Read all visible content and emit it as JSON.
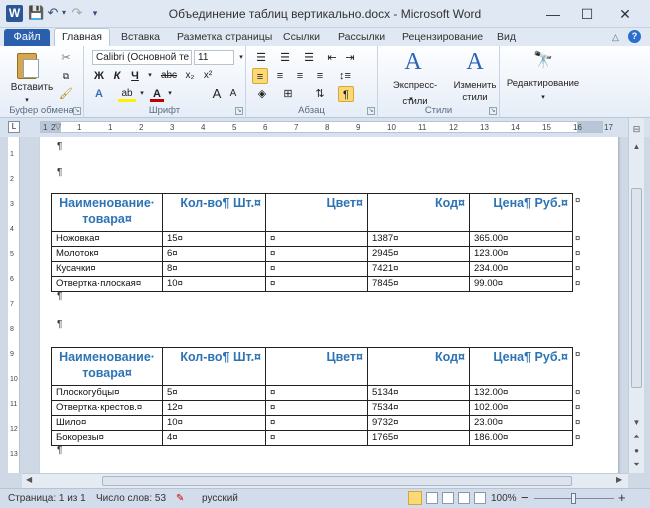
{
  "app": {
    "title": "Объединение таблиц вертикально.docx  -  Microsoft Word",
    "logo_letter": "W",
    "qat": {
      "save": "💾",
      "undo": "↶",
      "redo": "↷"
    },
    "window_controls": {
      "minimize": "—",
      "maximize": "☐",
      "close": "✕"
    }
  },
  "ribbon_tabs": {
    "file": "Файл",
    "items": [
      "Главная",
      "Вставка",
      "Разметка страницы",
      "Ссылки",
      "Рассылки",
      "Рецензирование",
      "Вид"
    ]
  },
  "ribbon": {
    "clipboard": {
      "paste_label": "Вставить",
      "group_label": "Буфер обмена"
    },
    "font": {
      "font_name": "Calibri (Основной те",
      "font_size": "11",
      "grow": "A",
      "shrink": "A",
      "bold": "Ж",
      "italic": "К",
      "underline": "Ч",
      "strike": "abc",
      "subscript": "x₂",
      "superscript": "x²",
      "color_a": "A",
      "highlight": "ab",
      "font_color": "A",
      "case": "Aa",
      "group_label": "Шрифт"
    },
    "paragraph": {
      "pilcrow": "¶",
      "group_label": "Абзац"
    },
    "styles": {
      "express_label": "Экспресс-стили",
      "change_label": "Изменить",
      "change_label2": "стили",
      "group_label": "Стили"
    },
    "editing": {
      "label": "Редактирование"
    }
  },
  "ruler": {
    "numbers": [
      "1",
      "2",
      "1",
      "1",
      "2",
      "3",
      "4",
      "5",
      "6",
      "7",
      "8",
      "9",
      "10",
      "11",
      "12",
      "13",
      "14",
      "15",
      "16",
      "17"
    ],
    "tab_button": "L"
  },
  "vruler": {
    "numbers": [
      "1",
      "2",
      "3",
      "4",
      "5",
      "6",
      "7",
      "8",
      "9",
      "10",
      "11",
      "12",
      "13"
    ]
  },
  "document": {
    "pilcrow": "¶",
    "cell_mark": "¤",
    "headers": [
      "Наименование· товара¤",
      "Кол-во¶ Шт.¤",
      "Цвет¤",
      "Код¤",
      "Цена¶ Руб.¤"
    ],
    "table1": [
      [
        "Ножовка¤",
        "15¤",
        "¤",
        "1387¤",
        "365.00¤"
      ],
      [
        "Молоток¤",
        "6¤",
        "¤",
        "2945¤",
        "123.00¤"
      ],
      [
        "Кусачки¤",
        "8¤",
        "¤",
        "7421¤",
        "234.00¤"
      ],
      [
        "Отвертка·плоская¤",
        "10¤",
        "¤",
        "7845¤",
        "99.00¤"
      ]
    ],
    "table2": [
      [
        "Плоскогубцы¤",
        "5¤",
        "¤",
        "5134¤",
        "132.00¤"
      ],
      [
        "Отвертка·крестов.¤",
        "12¤",
        "¤",
        "7534¤",
        "102.00¤"
      ],
      [
        "Шило¤",
        "10¤",
        "¤",
        "9732¤",
        "23.00¤"
      ],
      [
        "Бокорезы¤",
        "4¤",
        "¤",
        "1765¤",
        "186.00¤"
      ]
    ]
  },
  "statusbar": {
    "page": "Страница: 1 из 1",
    "words": "Число слов: 53",
    "language": "русский",
    "zoom": "100%",
    "zoom_minus": "−",
    "zoom_plus": "+"
  },
  "colors": {
    "accent": "#2a5fae",
    "header_text": "#2e74b5"
  }
}
